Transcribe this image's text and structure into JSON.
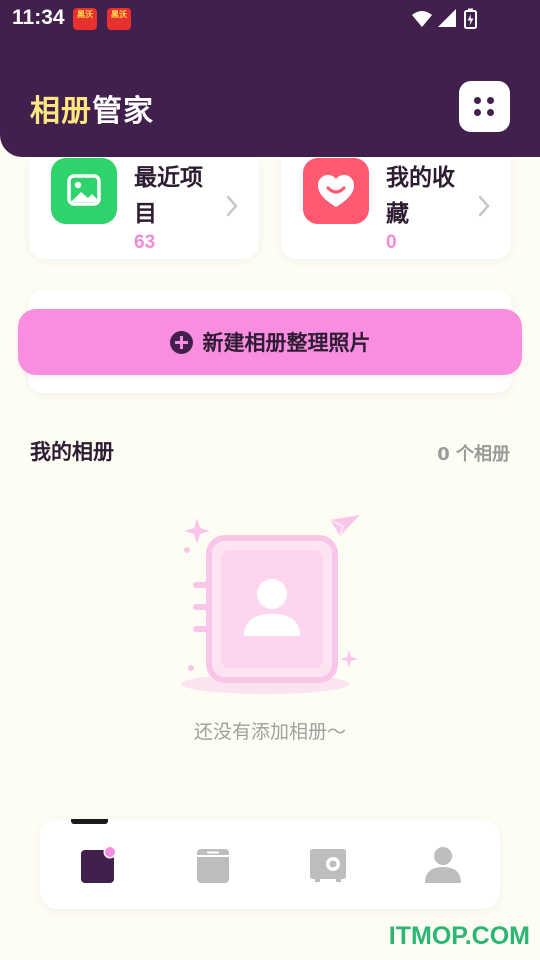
{
  "status_bar": {
    "time": "11:34",
    "notifications": [
      {
        "icon": "notification-app-icon",
        "text": "黑沃"
      },
      {
        "icon": "notification-app-icon",
        "text": "黑沃"
      }
    ],
    "system_icons": [
      "wifi-icon",
      "cell-signal-icon",
      "battery-charging-icon"
    ]
  },
  "header": {
    "title_part1": "相册",
    "title_part2": "管家",
    "menu_icon": "grid-dots-icon"
  },
  "quick_cards": [
    {
      "label": "最近项目",
      "count": "63",
      "icon": "image-icon",
      "color": "#2ed36b"
    },
    {
      "label": "我的收藏",
      "count": "0",
      "icon": "heart-smile-icon",
      "color": "#ff5a72"
    }
  ],
  "new_album_button": {
    "label": "新建相册整理照片",
    "icon": "plus-circle-icon"
  },
  "albums": {
    "title": "我的相册",
    "count_label": "0 个相册",
    "empty_text": "还没有添加相册～"
  },
  "bottom_nav": [
    {
      "name": "home",
      "icon": "album-home-icon",
      "active": true
    },
    {
      "name": "archive",
      "icon": "box-icon",
      "active": false
    },
    {
      "name": "safe",
      "icon": "safe-icon",
      "active": false
    },
    {
      "name": "profile",
      "icon": "person-icon",
      "active": false
    }
  ],
  "watermark": "ITMOP.COM",
  "colors": {
    "header": "#42204d",
    "accent_pink": "#f98ee1",
    "background": "#fefdf3",
    "count_pink": "#f48ad7"
  }
}
